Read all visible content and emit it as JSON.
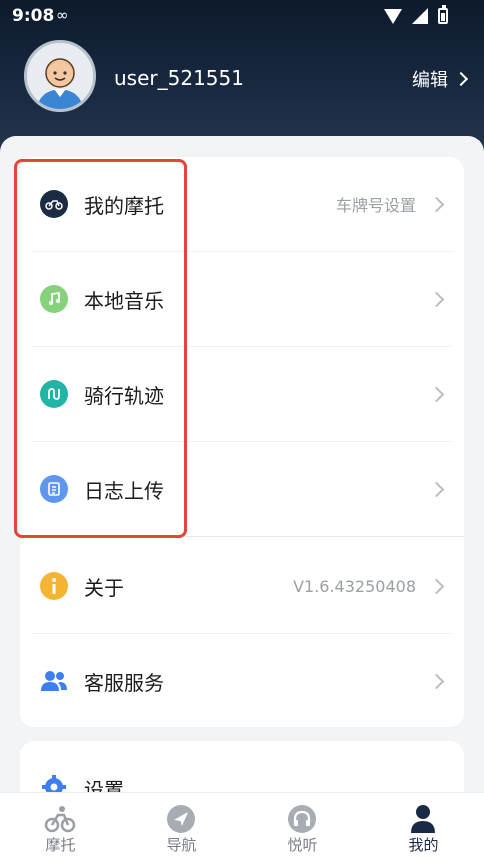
{
  "status_bar": {
    "time": "9:08",
    "extra": "∞"
  },
  "profile": {
    "username": "user_521551",
    "edit_label": "编辑"
  },
  "menu_group_1": [
    {
      "label": "我的摩托",
      "value": "车牌号设置",
      "icon": "motorcycle-icon",
      "color": "#1c2b44"
    },
    {
      "label": "本地音乐",
      "value": "",
      "icon": "music-note-icon",
      "color": "#86d27a"
    },
    {
      "label": "骑行轨迹",
      "value": "",
      "icon": "route-icon",
      "color": "#22b5a6"
    },
    {
      "label": "日志上传",
      "value": "",
      "icon": "document-icon",
      "color": "#5f97f0"
    }
  ],
  "menu_group_2": [
    {
      "label": "关于",
      "value": "V1.6.43250408",
      "icon": "info-icon",
      "color": "#f5b534"
    },
    {
      "label": "客服服务",
      "value": "",
      "icon": "customer-service-icon",
      "color": "#3e7ff0"
    }
  ],
  "menu_group_3": [
    {
      "label": "设置",
      "icon": "gear-icon",
      "color": "#3e7ff0"
    }
  ],
  "tab_bar": [
    {
      "label": "摩托",
      "icon": "motorcycle-tab-icon",
      "active": false
    },
    {
      "label": "导航",
      "icon": "navigation-icon",
      "active": false
    },
    {
      "label": "悦听",
      "icon": "headphones-icon",
      "active": false
    },
    {
      "label": "我的",
      "icon": "profile-icon",
      "active": true
    }
  ],
  "colors": {
    "header_dark": "#0d1a2c",
    "highlight": "#e2463a",
    "active_tab": "#1b2a44"
  }
}
